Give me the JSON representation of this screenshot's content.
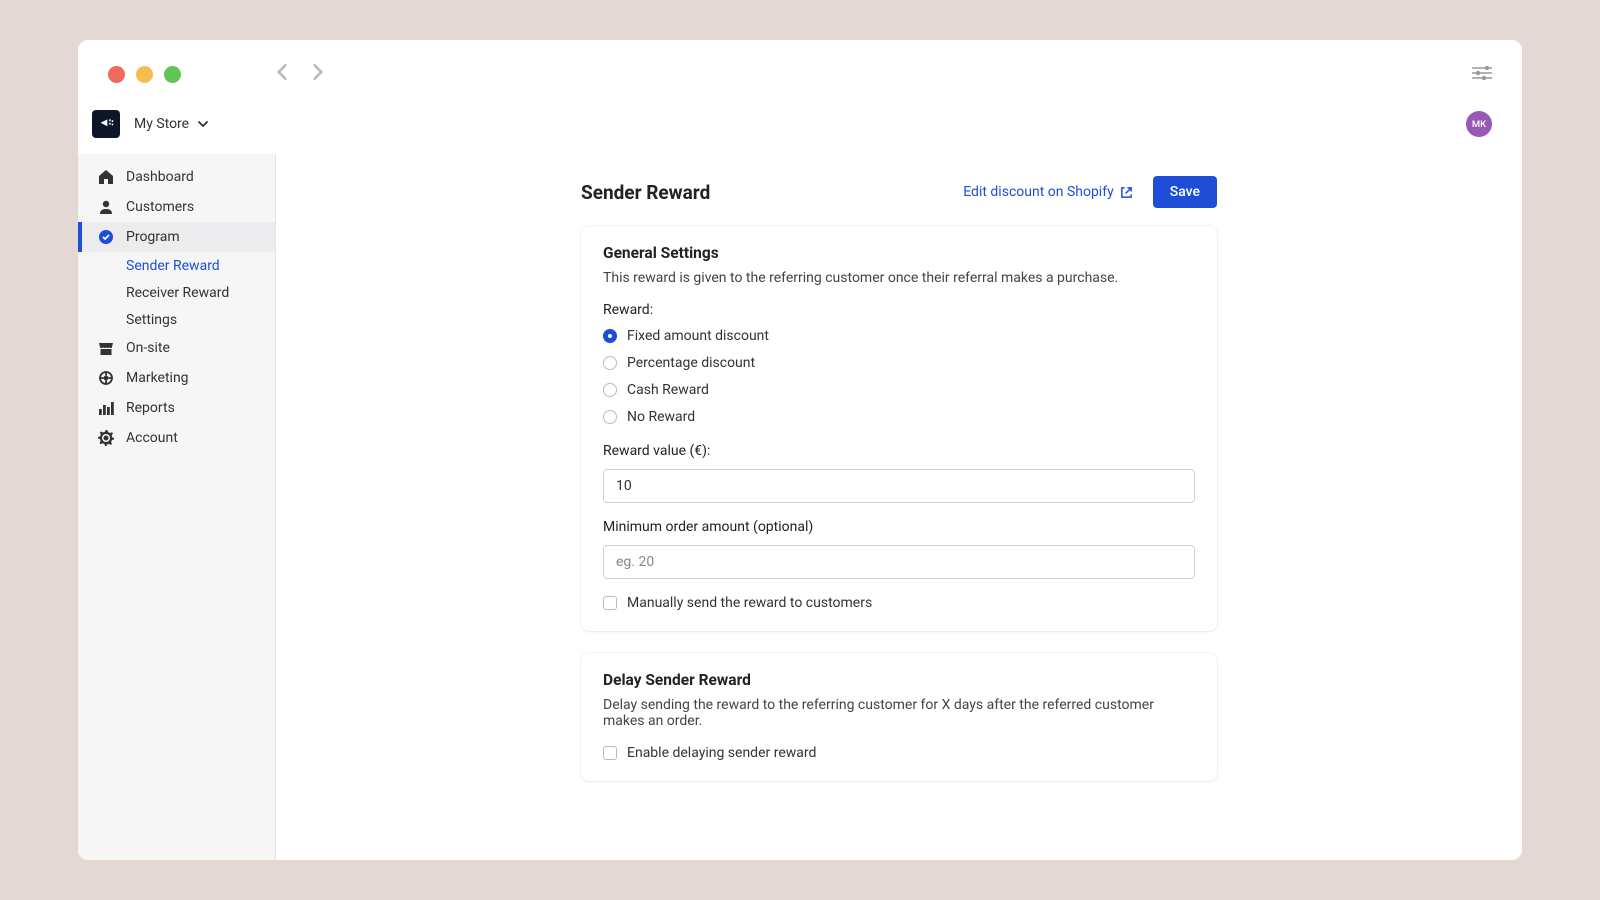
{
  "header": {
    "store_name": "My Store",
    "avatar_initials": "MK"
  },
  "sidebar": {
    "items": [
      {
        "label": "Dashboard"
      },
      {
        "label": "Customers"
      },
      {
        "label": "Program"
      },
      {
        "label": "On-site"
      },
      {
        "label": "Marketing"
      },
      {
        "label": "Reports"
      },
      {
        "label": "Account"
      }
    ],
    "program_subitems": [
      {
        "label": "Sender Reward"
      },
      {
        "label": "Receiver Reward"
      },
      {
        "label": "Settings"
      }
    ]
  },
  "page": {
    "title": "Sender Reward",
    "edit_link": "Edit discount on Shopify",
    "save_label": "Save"
  },
  "general": {
    "title": "General Settings",
    "description": "This reward is given to the referring customer once their referral makes a purchase.",
    "reward_label": "Reward:",
    "options": {
      "fixed": "Fixed amount discount",
      "percentage": "Percentage discount",
      "cash": "Cash Reward",
      "none": "No Reward"
    },
    "value_label": "Reward value (€):",
    "value": "10",
    "min_order_label": "Minimum order amount (optional)",
    "min_order_placeholder": "eg. 20",
    "manual_checkbox": "Manually send the reward to customers"
  },
  "delay": {
    "title": "Delay Sender Reward",
    "description": "Delay sending the reward to the referring customer for X days after the referred customer makes an order.",
    "enable_checkbox": "Enable delaying sender reward"
  }
}
